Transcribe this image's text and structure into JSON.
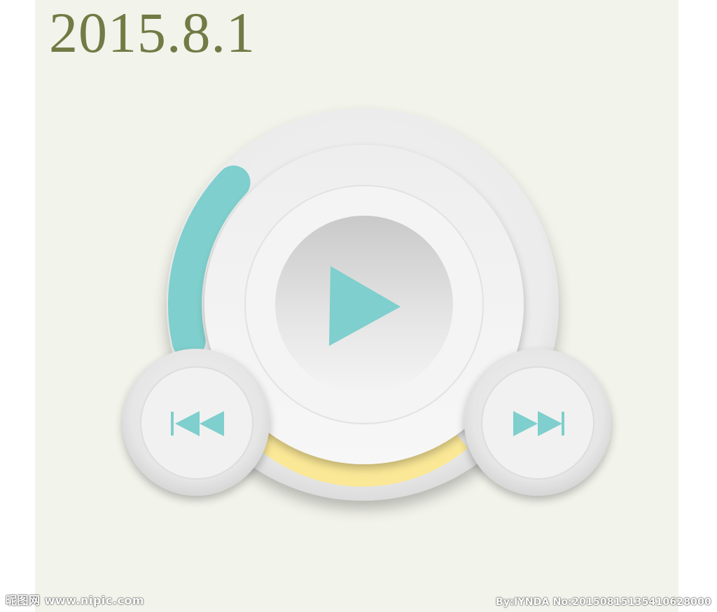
{
  "header": {
    "date": "2015.8.1"
  },
  "player": {
    "progress_fraction": 0.14,
    "colors": {
      "background": "#f2f3eb",
      "accent_teal": "#7ecfcd",
      "accent_yellow": "#fbe896",
      "date_text": "#727a45",
      "button_face": "#f0f0f0"
    },
    "buttons": {
      "play_icon": "play-icon",
      "prev_icon": "skip-previous-icon",
      "next_icon": "skip-next-icon"
    }
  },
  "watermark": {
    "logo_text": "昵图网 www.nipic.com",
    "credit_text": "By:IYNDA No:20150815135410628000"
  }
}
